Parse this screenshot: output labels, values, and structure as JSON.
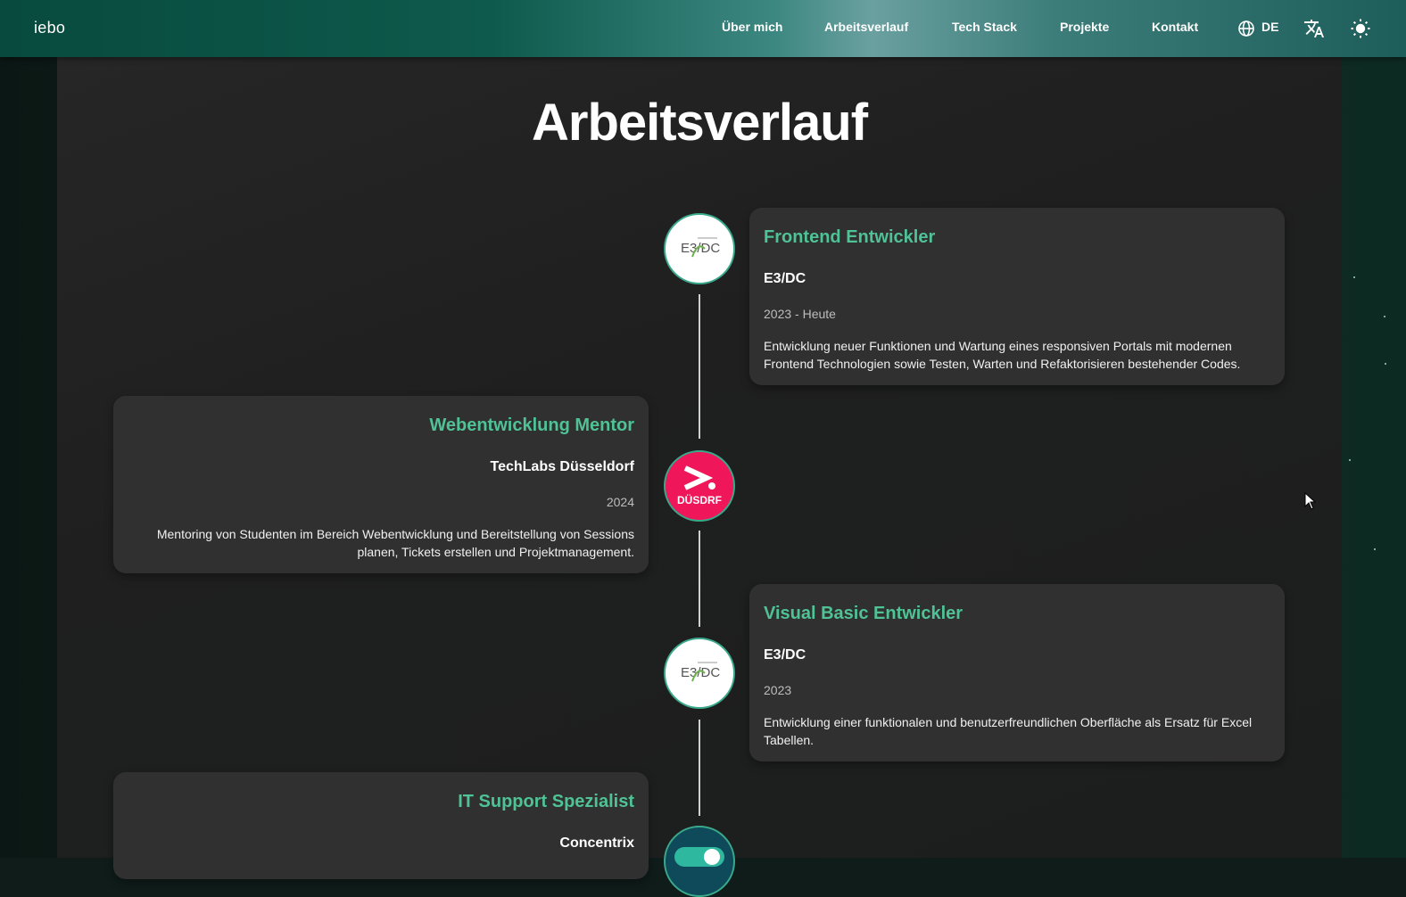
{
  "navbar": {
    "logo": "iebo",
    "links": [
      {
        "label": "Über mich"
      },
      {
        "label": "Arbeitsverlauf"
      },
      {
        "label": "Tech Stack"
      },
      {
        "label": "Projekte"
      },
      {
        "label": "Kontakt"
      }
    ],
    "language": "DE",
    "icons": [
      "globe-icon",
      "translate-icon",
      "sun-icon"
    ]
  },
  "section": {
    "title": "Arbeitsverlauf"
  },
  "timeline": [
    {
      "title": "Frontend Entwickler",
      "company": "E3/DC",
      "date": "2023 - Heute",
      "description": "Entwicklung neuer Funktionen und Wartung eines responsiven Portals mit modernen Frontend Technologien sowie Testen, Warten und Refaktorisieren bestehender Codes.",
      "logo": "E3/DC",
      "side": "right"
    },
    {
      "title": "Webentwicklung Mentor",
      "company": "TechLabs Düsseldorf",
      "date": "2024",
      "description": "Mentoring von Studenten im Bereich Webentwicklung und Bereitstellung von Sessions planen, Tickets erstellen und Projektmanagement.",
      "logo": "DÜSDRF",
      "side": "left"
    },
    {
      "title": "Visual Basic Entwickler",
      "company": "E3/DC",
      "date": "2023",
      "description": "Entwicklung einer funktionalen und benutzerfreundlichen Oberfläche als Ersatz für Excel Tabellen.",
      "logo": "E3/DC",
      "side": "right"
    },
    {
      "title": "IT Support Spezialist",
      "company": "Concentrix",
      "side": "left"
    }
  ],
  "colors": {
    "accent": "#4fc296",
    "card_bg": "#303030",
    "techlabs_pink": "#f0165a"
  }
}
